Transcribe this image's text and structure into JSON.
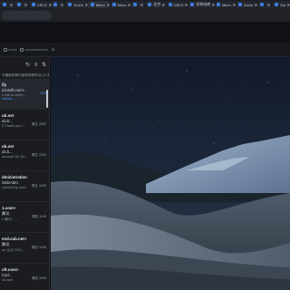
{
  "tabs": [
    {
      "label": "",
      "active": false
    },
    {
      "label": "",
      "active": false
    },
    {
      "label": "CRLD",
      "active": false
    },
    {
      "label": "",
      "active": false
    },
    {
      "label": "GuGu",
      "active": false
    },
    {
      "label": "Micro",
      "active": true
    },
    {
      "label": "Micro",
      "active": false
    },
    {
      "label": "",
      "active": false
    },
    {
      "label": "北京",
      "active": false
    },
    {
      "label": "CRLD",
      "active": false
    },
    {
      "label": "深林电商",
      "active": false
    },
    {
      "label": "Micro",
      "active": false
    },
    {
      "label": "GuGu",
      "active": false
    },
    {
      "label": "",
      "active": false
    },
    {
      "label": "Gol",
      "active": false
    }
  ],
  "pane": {
    "subheader": "与最新的邮件接收的邮件(8) 10 天以头上 删除所",
    "messages": [
      {
        "from": "ify",
        "subject": "icrosoft.com>",
        "preview": "n link to verify ...",
        "tag": "website...",
        "date": "TIMI",
        "date_blue": true,
        "selected": true
      },
      {
        "from": "ub.net",
        "subject": "ub.b...",
        "preview": "S Thank you f...",
        "tag": "",
        "date": "周五 2052",
        "date_blue": false,
        "selected": false
      },
      {
        "from": "ub.net",
        "subject": "ub.b...",
        "preview": "account Gu Gu...",
        "tag": "",
        "date": "周五 2032",
        "date_blue": false,
        "selected": false
      },
      {
        "from": "dministration",
        "subject": "GBizAdm",
        "preview": "owered by host...",
        "tag": "",
        "date": "周五 1043",
        "date_blue": false,
        "selected": false
      },
      {
        "from": "1.com>",
        "subject": "腾讯",
        "preview": "n 腾讯... ...",
        "tag": "",
        "date": "周四 1149",
        "date_blue": false,
        "selected": false
      },
      {
        "from": "end.cub.net>",
        "subject": "腾讯",
        "preview": "ou 认识 2001...",
        "tag": "",
        "date": "周四 1025",
        "date_blue": false,
        "selected": false
      },
      {
        "from": "oft.com>",
        "subject": "Cod...",
        "preview": "ok.com",
        "tag": "",
        "date": "周四 1009",
        "date_blue": false,
        "selected": false
      }
    ]
  },
  "icons": {
    "refresh": "refresh-icon",
    "filter": "filter-icon",
    "sort": "sort-icon"
  },
  "colors": {
    "accent": "#3f8be6",
    "pane_bg": "#1a1c20",
    "sky_top": "#15202f",
    "dune": "#5f6d7e"
  }
}
